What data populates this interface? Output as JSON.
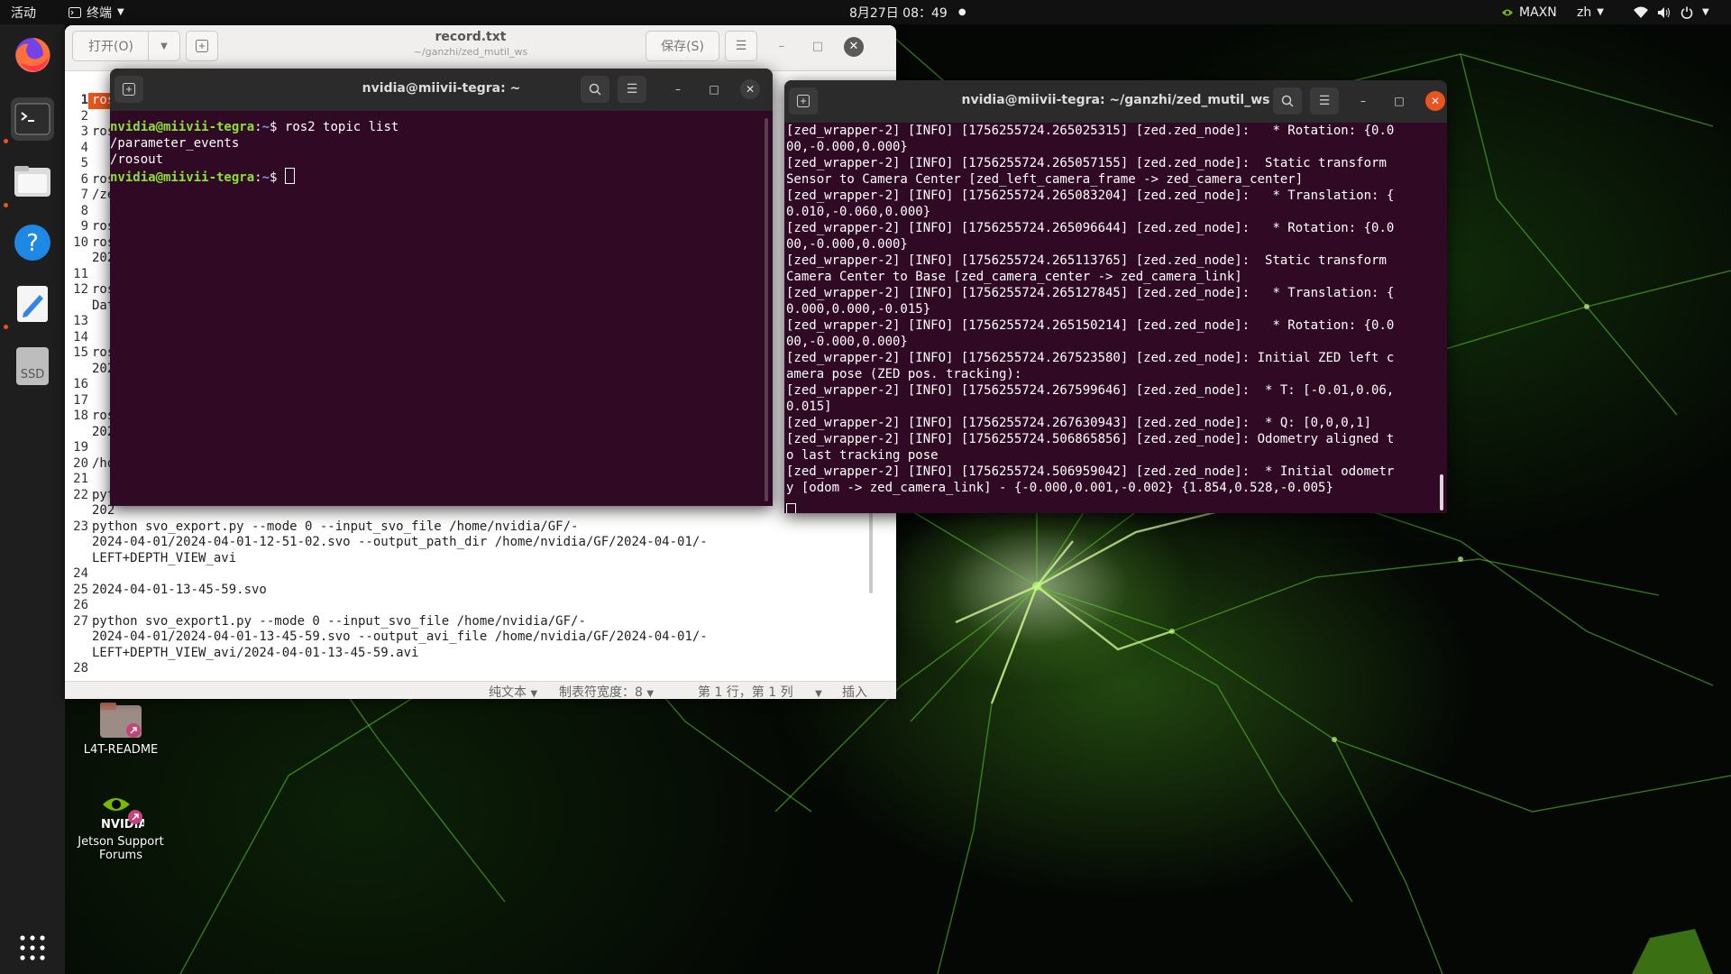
{
  "topbar": {
    "activities": "活动",
    "app_menu": "终端",
    "clock": "8月27日  08：49",
    "power_mode": "MAXN",
    "lang": "zh"
  },
  "dock": {
    "items": [
      {
        "name": "firefox",
        "icon": "firefox-icon"
      },
      {
        "name": "terminal",
        "icon": "terminal-icon"
      },
      {
        "name": "files",
        "icon": "files-icon"
      },
      {
        "name": "help",
        "icon": "help-icon"
      },
      {
        "name": "text-editor",
        "icon": "text-editor-icon"
      },
      {
        "name": "ssd",
        "label": "SSD",
        "icon": "ssd-drive-icon"
      },
      {
        "name": "show-apps",
        "icon": "grid-icon"
      }
    ]
  },
  "desktop": {
    "icons": [
      {
        "label": "L4T-README",
        "icon": "folder-link-icon"
      },
      {
        "label": "Jetson Support Forums",
        "icon": "nvidia-link-icon",
        "logo_text": "NVIDIA"
      }
    ]
  },
  "gedit": {
    "open_label": "打开(O)",
    "save_label": "保存(S)",
    "title": "record.txt",
    "subtitle": "~/ganzhi/zed_mutil_ws",
    "line_numbers": [
      "1",
      "2",
      "3",
      "4",
      "5",
      "6",
      "7",
      "8",
      "9",
      "10",
      "",
      "11",
      "12",
      "",
      "13",
      "14",
      "15",
      "",
      "16",
      "17",
      "18",
      "",
      "19",
      "20",
      "21",
      "22",
      "",
      "23",
      "",
      "",
      "24",
      "25",
      "26",
      "27",
      "",
      "",
      "28"
    ],
    "lines": [
      "ros",
      "",
      "ros",
      "",
      "",
      "ros",
      "/ze",
      "",
      "ros",
      "ros",
      "202",
      "",
      "ros",
      "Dat",
      "",
      "",
      "ros",
      "202",
      "",
      "",
      "ros",
      "202",
      "",
      "/ho",
      "",
      "pyt",
      "202",
      "python svo_export.py --mode 0 --input_svo_file /home/nvidia/GF/-",
      "2024-04-01/2024-04-01-12-51-02.svo --output_path_dir /home/nvidia/GF/2024-04-01/-",
      "LEFT+DEPTH_VIEW_avi",
      "",
      "2024-04-01-13-45-59.svo",
      "",
      "python svo_export1.py --mode 0 --input_svo_file /home/nvidia/GF/-",
      "2024-04-01/2024-04-01-13-45-59.svo --output_avi_file /home/nvidia/GF/2024-04-01/-",
      "LEFT+DEPTH_VIEW_avi/2024-04-01-13-45-59.avi",
      ""
    ],
    "status": {
      "mode": "纯文本",
      "tab_width": "制表符宽度：8",
      "position": "第 1 行，第 1 列",
      "insert": "插入"
    }
  },
  "terminal1": {
    "title": "nvidia@miivii-tegra: ~",
    "user": "nvidia@miivii-tegra",
    "sep": ":",
    "path": "~",
    "dollar": "$ ",
    "command": "ros2 topic list",
    "output": [
      "/parameter_events",
      "/rosout"
    ]
  },
  "terminal2": {
    "title": "nvidia@miivii-tegra: ~/ganzhi/zed_mutil_ws",
    "lines": [
      "[zed_wrapper-2] [INFO] [1756255724.265025315] [zed.zed_node]:   * Rotation: {0.0",
      "00,-0.000,0.000}",
      "[zed_wrapper-2] [INFO] [1756255724.265057155] [zed.zed_node]:  Static transform",
      "Sensor to Camera Center [zed_left_camera_frame -> zed_camera_center]",
      "[zed_wrapper-2] [INFO] [1756255724.265083204] [zed.zed_node]:   * Translation: {",
      "0.010,-0.060,0.000}",
      "[zed_wrapper-2] [INFO] [1756255724.265096644] [zed.zed_node]:   * Rotation: {0.0",
      "00,-0.000,0.000}",
      "[zed_wrapper-2] [INFO] [1756255724.265113765] [zed.zed_node]:  Static transform",
      "Camera Center to Base [zed_camera_center -> zed_camera_link]",
      "[zed_wrapper-2] [INFO] [1756255724.265127845] [zed.zed_node]:   * Translation: {",
      "0.000,0.000,-0.015}",
      "[zed_wrapper-2] [INFO] [1756255724.265150214] [zed.zed_node]:   * Rotation: {0.0",
      "00,-0.000,0.000}",
      "[zed_wrapper-2] [INFO] [1756255724.267523580] [zed.zed_node]: Initial ZED left c",
      "amera pose (ZED pos. tracking):",
      "[zed_wrapper-2] [INFO] [1756255724.267599646] [zed.zed_node]:  * T: [-0.01,0.06,",
      "0.015]",
      "[zed_wrapper-2] [INFO] [1756255724.267630943] [zed.zed_node]:  * Q: [0,0,0,1]",
      "[zed_wrapper-2] [INFO] [1756255724.506865856] [zed.zed_node]: Odometry aligned t",
      "o last tracking pose",
      "[zed_wrapper-2] [INFO] [1756255724.506959042] [zed.zed_node]:  * Initial odometr",
      "y [odom -> zed_camera_link] - {-0.000,0.001,-0.002} {1.854,0.528,-0.005}"
    ]
  },
  "colors": {
    "terminal_bg": "#300a24",
    "prompt_user": "#8ae234",
    "prompt_path": "#729fcf",
    "accent": "#e95420"
  }
}
